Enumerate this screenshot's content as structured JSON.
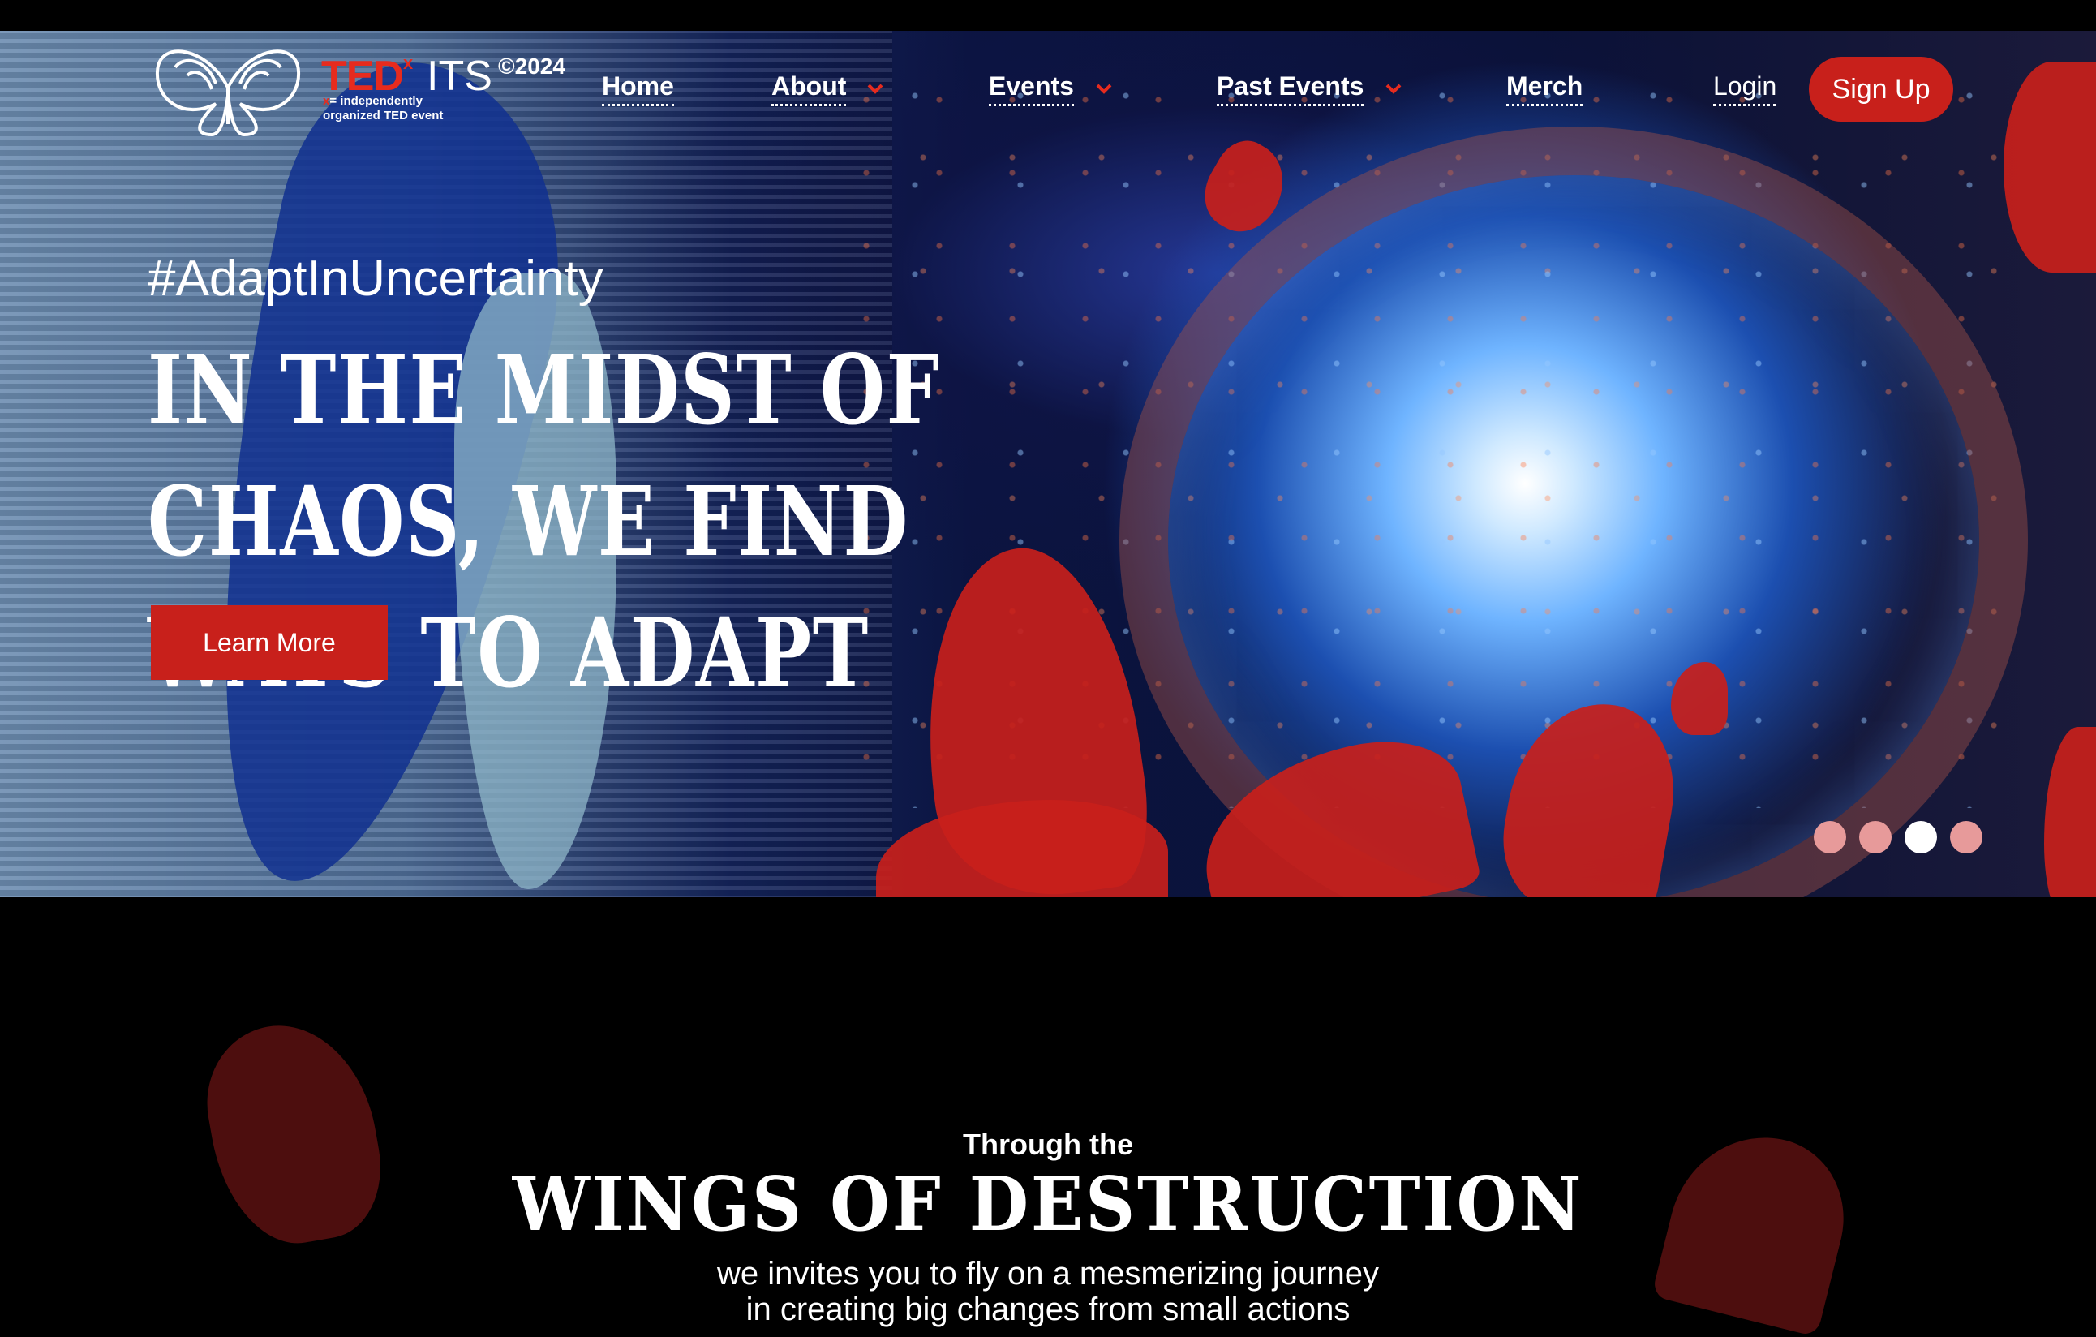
{
  "nav": {
    "logo": {
      "brand": "TED",
      "brand_superscript": "x",
      "suffix": "ITS",
      "year": "©2024",
      "subtitle_x": "x",
      "subtitle_line1": "= independently",
      "subtitle_line2": "organized TED event"
    },
    "items": [
      {
        "label": "Home",
        "has_dropdown": false
      },
      {
        "label": "About",
        "has_dropdown": true
      },
      {
        "label": "Events",
        "has_dropdown": true
      },
      {
        "label": "Past Events",
        "has_dropdown": true
      },
      {
        "label": "Merch",
        "has_dropdown": false
      }
    ],
    "login_label": "Login",
    "signup_label": "Sign Up"
  },
  "hero": {
    "hashtag": "#AdaptInUncertainty",
    "headline_line1": "IN THE MIDST OF CHAOS, WE FIND",
    "headline_line2": "WAYS TO ADAPT",
    "cta_label": "Learn More",
    "slides_total": 4,
    "active_slide_index": 2
  },
  "intro": {
    "kicker": "Through the",
    "title": "WINGS OF DESTRUCTION",
    "tagline_line1": "we invites you to fly on a mesmerizing journey",
    "tagline_line2": "in creating big changes from small actions"
  },
  "colors": {
    "accent": "#c8201b",
    "ted_red": "#e62b1e",
    "background": "#000000",
    "dot_inactive": "#e79a9a",
    "dot_active": "#ffffff"
  }
}
